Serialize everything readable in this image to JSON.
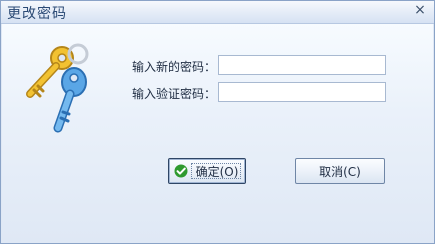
{
  "window": {
    "title": "更改密码",
    "close_glyph": "×"
  },
  "form": {
    "new_password_label": "输入新的密码：",
    "new_password_value": "",
    "confirm_password_label": "输入验证密码：",
    "confirm_password_value": ""
  },
  "buttons": {
    "ok_label": "确定(O)",
    "cancel_label": "取消(C)"
  },
  "icons": {
    "keys": "keys-icon",
    "ok_check": "check-icon"
  }
}
